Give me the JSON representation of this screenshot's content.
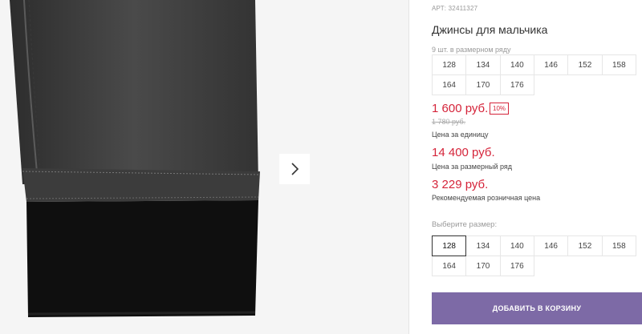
{
  "product": {
    "article": "АРТ: 32411327",
    "title": "Джинсы для мальчика",
    "sizes_hint": "9 шт. в размерном ряду",
    "sizes_row": [
      "128",
      "134",
      "140",
      "146",
      "152",
      "158",
      "164",
      "170",
      "176"
    ],
    "price": "1 600 руб.",
    "discount": "10%",
    "old_price": "1 780 руб.",
    "price_note": "Цена за единицу",
    "set_price": "14 400 руб.",
    "set_note": "Цена за размерный ряд",
    "retail_price": "3 229 руб.",
    "retail_note": "Рекомендуемая розничная цена",
    "choose_label": "Выберите размер:",
    "choose_sizes": [
      "128",
      "134",
      "140",
      "146",
      "152",
      "158",
      "164",
      "170",
      "176"
    ],
    "selected_size": "128",
    "cart_button": "ДОБАВИТЬ В КОРЗИНУ"
  },
  "colors": {
    "accent": "#d5243a",
    "button": "#7d6aa6"
  },
  "icons": {
    "next": "chevron-right-icon"
  }
}
